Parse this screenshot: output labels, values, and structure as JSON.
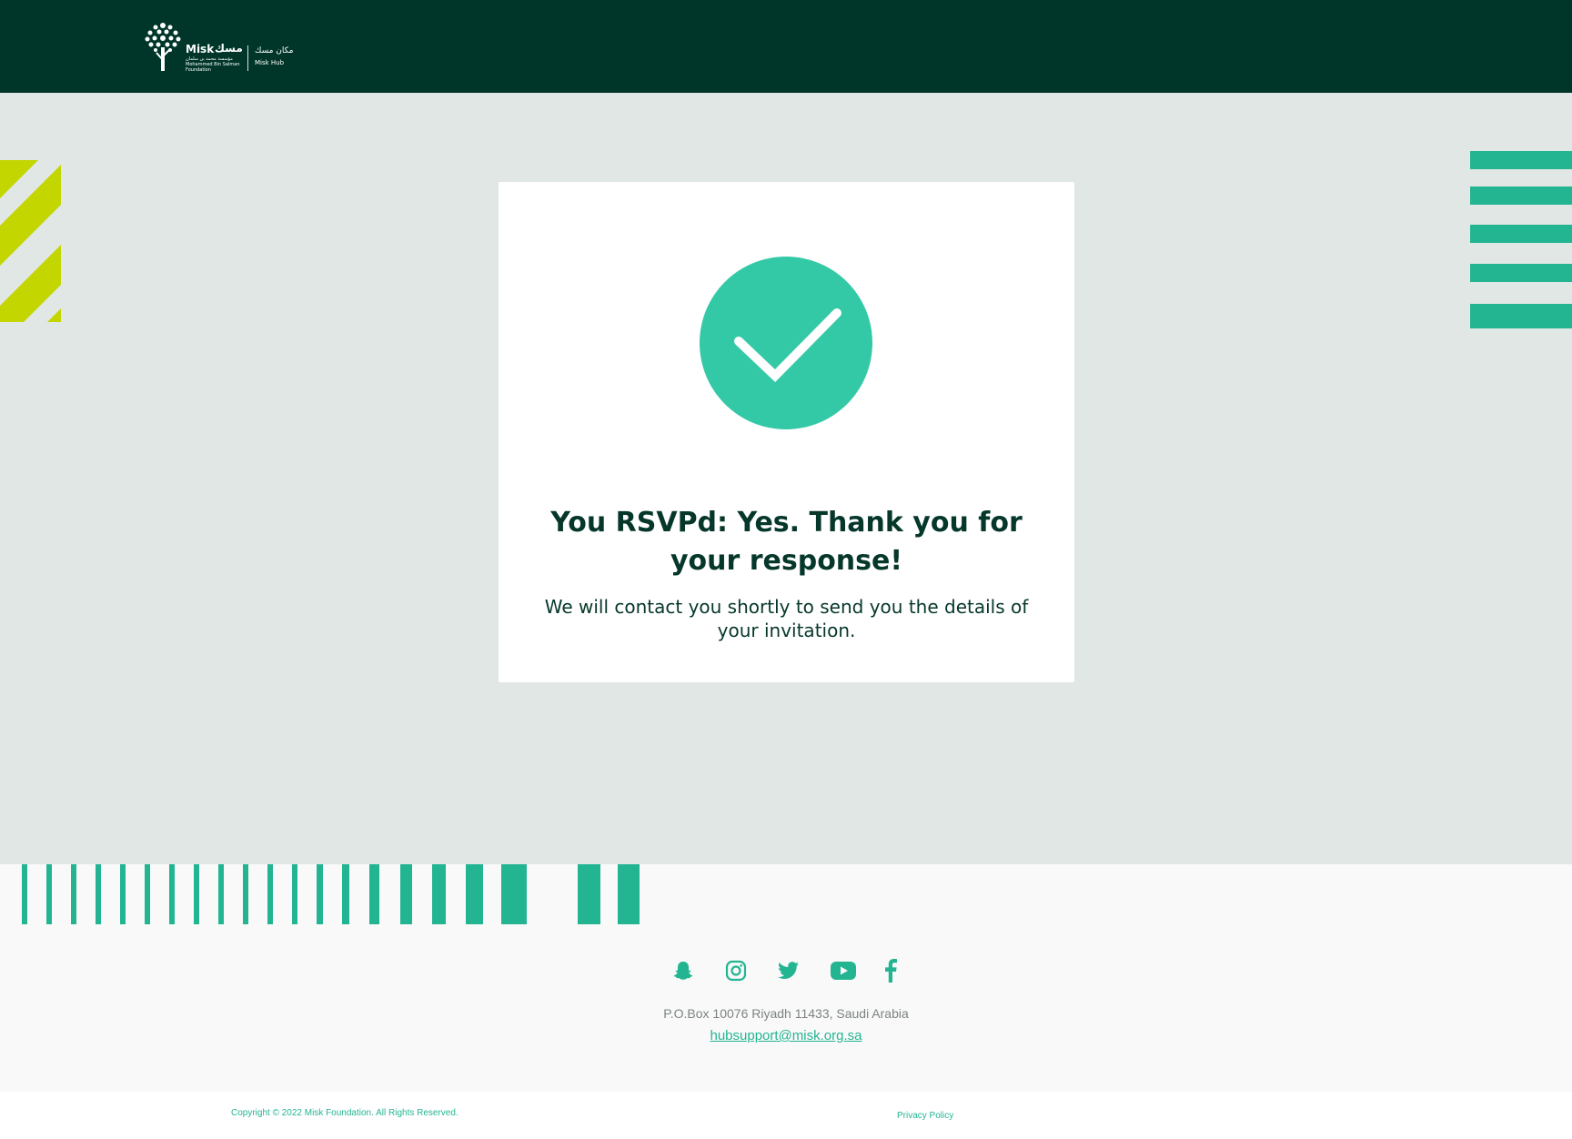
{
  "header": {
    "logo": {
      "name_en": "Misk",
      "name_ar": "مسك",
      "foundation_ar": "مؤسسة محمد بن سلمان",
      "foundation_en": "Mohammed Bin Salman Foundation",
      "hub_ar": "مكان مسك",
      "hub_en": "Misk Hub"
    },
    "background_color": "#003629"
  },
  "confirmation": {
    "icon": "check-circle-icon",
    "title": "You RSVPd: Yes. Thank you for your response!",
    "message": "We will contact you shortly to send you the details of your invitation."
  },
  "footer": {
    "social": [
      {
        "name": "snapchat-icon"
      },
      {
        "name": "instagram-icon"
      },
      {
        "name": "twitter-icon"
      },
      {
        "name": "youtube-icon"
      },
      {
        "name": "facebook-icon"
      }
    ],
    "address": "P.O.Box 10076 Riyadh 11433, Saudi Arabia",
    "email": "hubsupport@misk.org.sa",
    "copyright": "Copyright © 2022 Misk Foundation. All Rights Reserved.",
    "privacy_label": "Privacy Policy"
  },
  "colors": {
    "accent": "#23b592",
    "check": "#34c9a6",
    "yellow": "#c3d600",
    "text_dark": "#06372b",
    "page_bg": "#e1e7e5"
  }
}
